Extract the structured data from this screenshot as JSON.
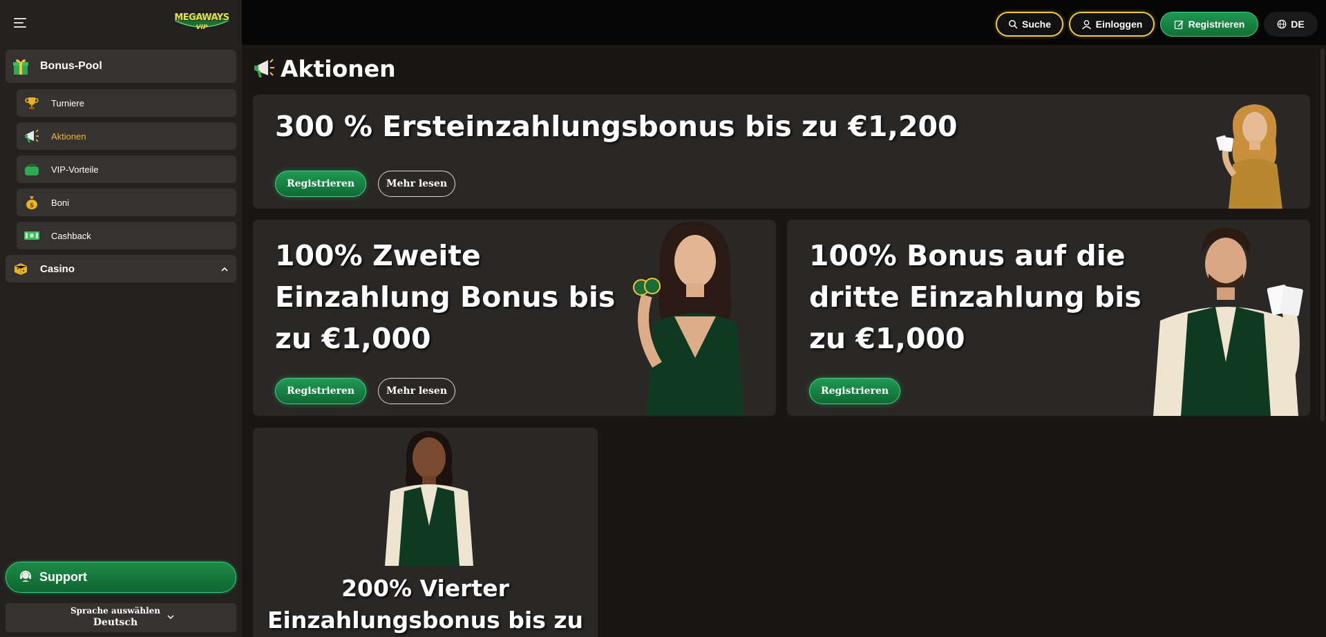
{
  "logo": {
    "text": "MEGAWAYS",
    "sub": "VIP"
  },
  "sidebar": {
    "bonus_pool": {
      "label": "Bonus-Pool",
      "icon": "gift-icon"
    },
    "items": [
      {
        "label": "Turniere",
        "icon": "trophy-icon"
      },
      {
        "label": "Aktionen",
        "icon": "megaphone-icon",
        "active": true
      },
      {
        "label": "VIP-Vorteile",
        "icon": "wallet-icon"
      },
      {
        "label": "Boni",
        "icon": "money-bag-icon"
      },
      {
        "label": "Cashback",
        "icon": "cash-icon"
      }
    ],
    "casino": {
      "label": "Casino",
      "icon": "dice-icon"
    },
    "support": {
      "label": "Support"
    },
    "language": {
      "caption": "Sprache auswählen",
      "value": "Deutsch"
    }
  },
  "header": {
    "search": "Suche",
    "login": "Einloggen",
    "register": "Registrieren",
    "lang": "DE"
  },
  "page": {
    "title": "Aktionen"
  },
  "promos": [
    {
      "title": "300 % Ersteinzahlungsbonus bis zu €1,200",
      "primary": "Registrieren",
      "secondary": "Mehr lesen"
    },
    {
      "title_lines": [
        "100% Zweite",
        "Einzahlung Bonus bis",
        "zu €1,000"
      ],
      "primary": "Registrieren",
      "secondary": "Mehr lesen"
    },
    {
      "title_lines": [
        "100% Bonus auf die",
        "dritte Einzahlung bis",
        "zu €1,000"
      ],
      "primary": "Registrieren"
    },
    {
      "title_lines": [
        "200% Vierter",
        "Einzahlungsbonus bis zu"
      ]
    }
  ],
  "colors": {
    "accent_gold": "#f0c846",
    "accent_green": "#1f9650",
    "active_text": "#f3b53a",
    "bg": "#1b1616",
    "card": "#2a2727"
  }
}
